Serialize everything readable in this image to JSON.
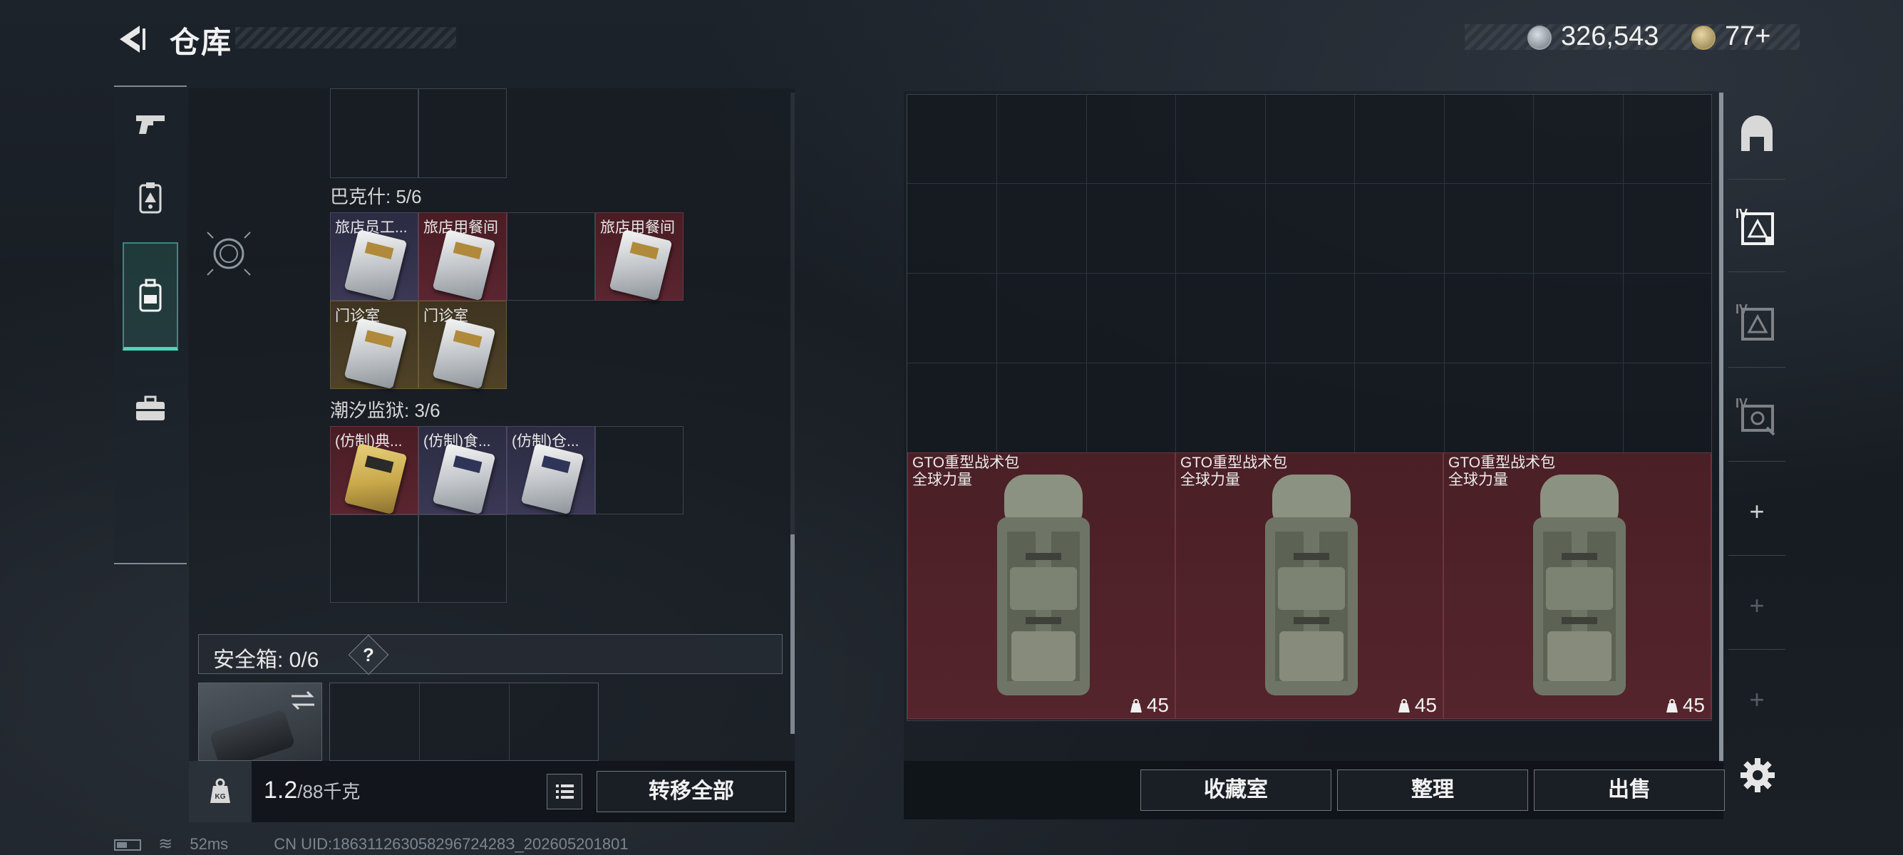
{
  "header": {
    "title": "仓库",
    "currency_primary": "326,543",
    "currency_secondary": "77+"
  },
  "left_nav": [
    {
      "name": "weapons",
      "icon": "pistol-icon"
    },
    {
      "name": "keys",
      "icon": "keycard-icon"
    },
    {
      "name": "backpack",
      "icon": "backpack-icon",
      "active": true
    },
    {
      "name": "toolbox",
      "icon": "briefcase-icon"
    }
  ],
  "keycard_sections": [
    {
      "label": "巴克什: 5/6",
      "items": [
        {
          "label": "旅店员工...",
          "rarity": "purple"
        },
        {
          "label": "旅店用餐间",
          "rarity": "red"
        },
        {
          "label": "",
          "rarity": "empty"
        },
        {
          "label": "旅店用餐间",
          "rarity": "red"
        },
        {
          "label": "门诊室",
          "rarity": "gold"
        },
        {
          "label": "门诊室",
          "rarity": "gold"
        }
      ]
    },
    {
      "label": "潮汐监狱: 3/6",
      "items": [
        {
          "label": "(仿制)典...",
          "rarity": "red"
        },
        {
          "label": "(仿制)食...",
          "rarity": "purple"
        },
        {
          "label": "(仿制)仓...",
          "rarity": "purple"
        }
      ]
    }
  ],
  "safe_box": {
    "label": "安全箱:  0/6",
    "help": "?"
  },
  "weight": {
    "current": "1.2",
    "max": "/88千克",
    "kg_label": "KG"
  },
  "buttons": {
    "transfer_all": "转移全部",
    "collection": "收藏室",
    "organize": "整理",
    "sell": "出售"
  },
  "stash_items": [
    {
      "name": "GTO重型战术包",
      "brand": "全球力量",
      "weight": "45"
    },
    {
      "name": "GTO重型战术包",
      "brand": "全球力量",
      "weight": "45"
    },
    {
      "name": "GTO重型战术包",
      "brand": "全球力量",
      "weight": "45"
    }
  ],
  "right_nav": [
    {
      "icon": "stash-icon"
    },
    {
      "icon": "stash-tier4-icon-1",
      "tier": "IV"
    },
    {
      "icon": "stash-tier4-icon-2",
      "tier": "IV"
    },
    {
      "icon": "stash-tier4-icon-3",
      "tier": "IV"
    },
    {
      "icon": "add-icon",
      "symbol": "+"
    },
    {
      "icon": "add-icon-disabled",
      "symbol": "+"
    },
    {
      "icon": "add-icon-disabled",
      "symbol": "+"
    }
  ],
  "footer": {
    "ping": "52ms",
    "uid": "CN UID:18631126305829672428З_202605201801"
  },
  "colors": {
    "accent": "#4fd6b8",
    "red_rarity": "#55242c",
    "purple_rarity": "#3a3854",
    "gold_rarity": "#4f4228"
  }
}
